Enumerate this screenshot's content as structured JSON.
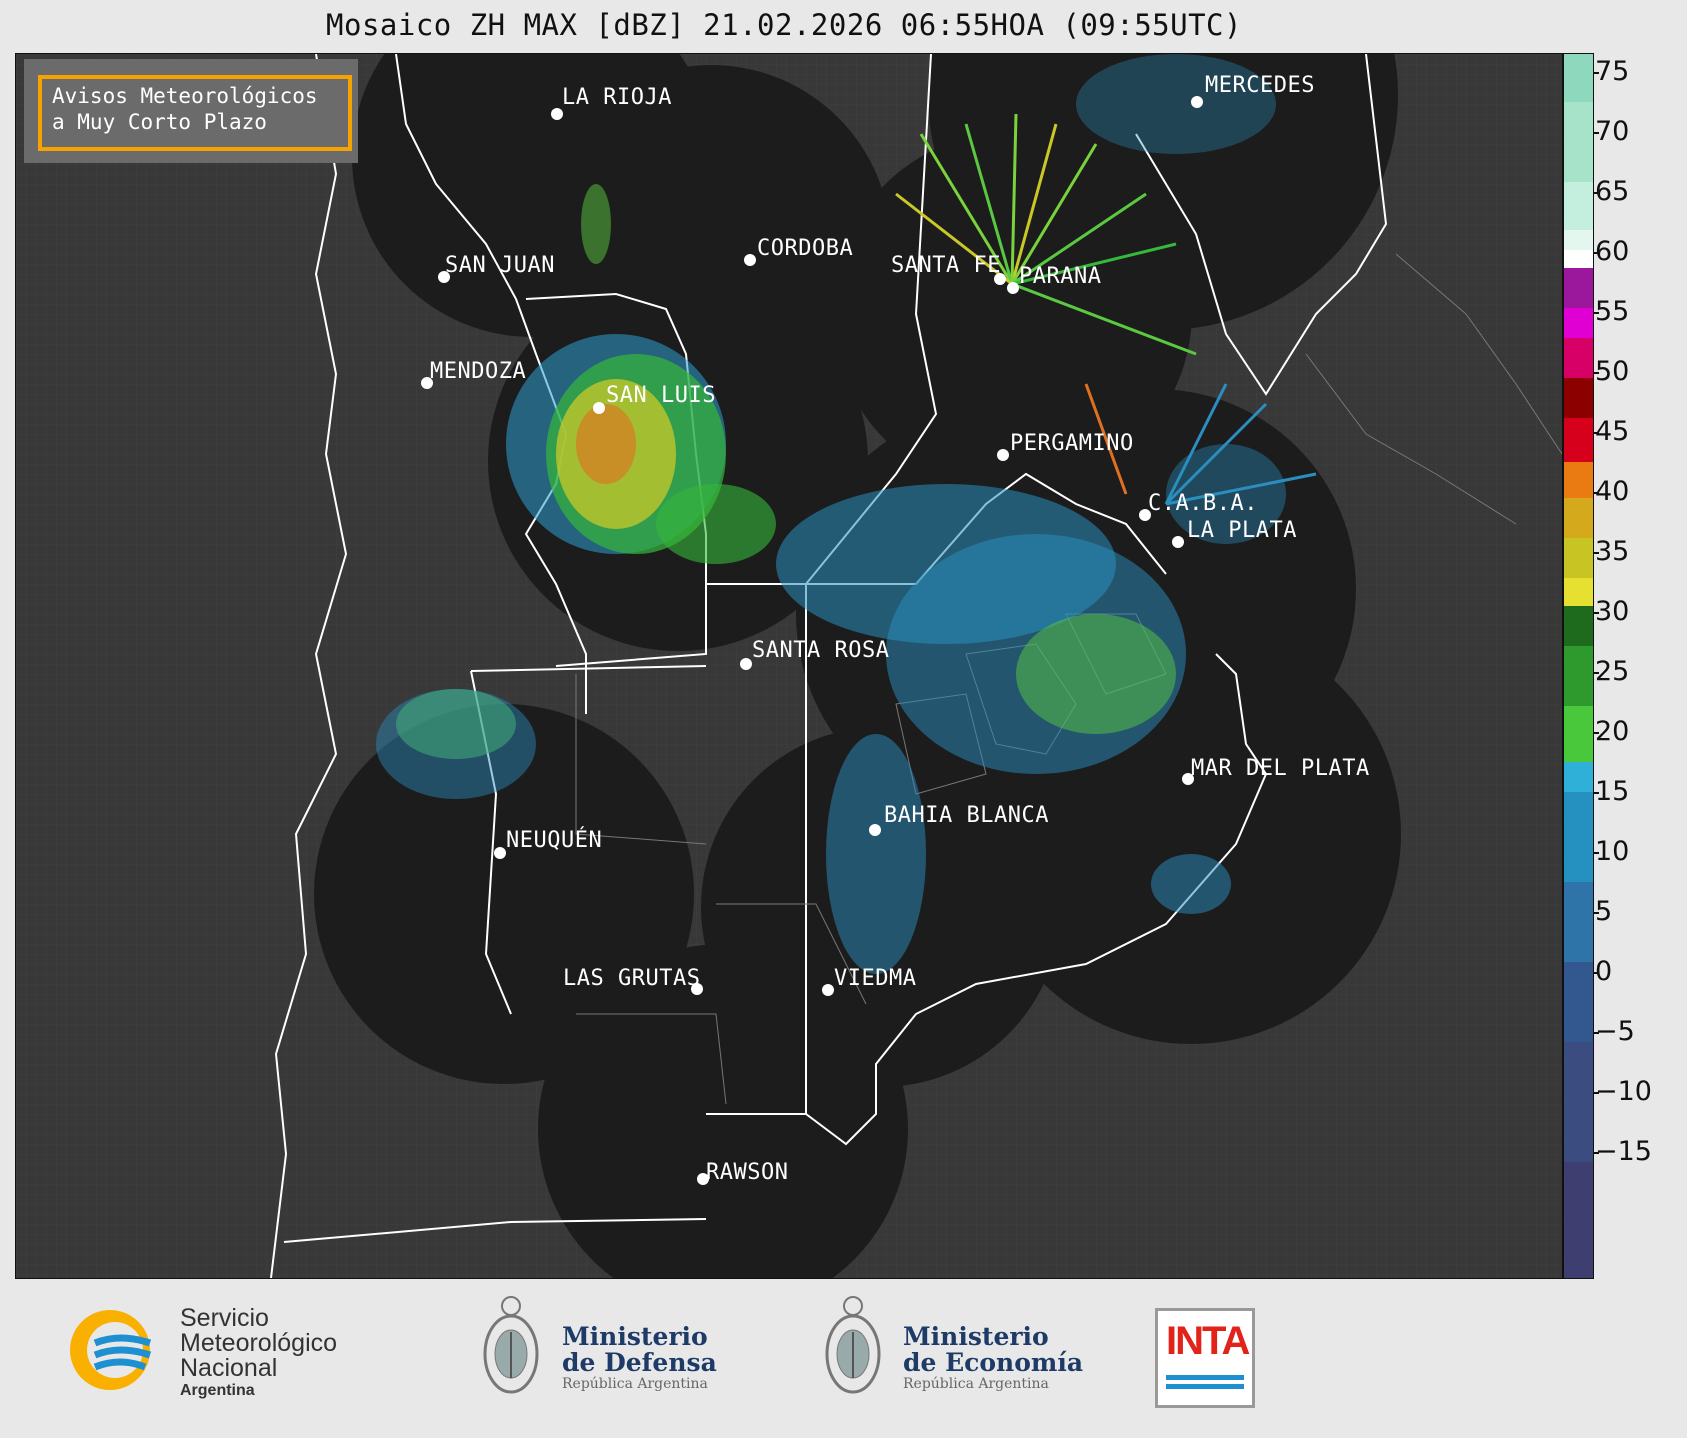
{
  "title": "Mosaico ZH MAX [dBZ] 21.02.2026 06:55HOA (09:55UTC)",
  "notice": {
    "line1": "Avisos Meteorológicos",
    "line2": "a Muy Corto Plazo"
  },
  "cities": [
    "LA RIOJA",
    "MERCEDES",
    "CORDOBA",
    "SAN JUAN",
    "SANTA FE",
    "PARANA",
    "MENDOZA",
    "SAN LUIS",
    "PERGAMINO",
    "C.A.B.A.",
    "LA PLATA",
    "SANTA ROSA",
    "MAR DEL PLATA",
    "BAHIA BLANCA",
    "NEUQUÉN",
    "LAS GRUTAS",
    "VIEDMA",
    "RAWSON"
  ],
  "colorbar": {
    "unit": "dBZ",
    "ticks": [
      "75",
      "70",
      "65",
      "60",
      "55",
      "50",
      "45",
      "40",
      "35",
      "30",
      "25",
      "20",
      "15",
      "10",
      "5",
      "0",
      "−5",
      "−10",
      "−15"
    ],
    "min": -19,
    "max": 77
  },
  "logos": {
    "smn": {
      "line1": "Servicio",
      "line2": "Meteorológico",
      "line3": "Nacional",
      "line4": "Argentina"
    },
    "defensa": {
      "line1": "Ministerio",
      "line2": "de Defensa",
      "line3": "República Argentina"
    },
    "economia": {
      "line1": "Ministerio",
      "line2": "de Economía",
      "line3": "República Argentina"
    },
    "inta": "INTA"
  },
  "colors": {
    "background": "#383838",
    "radar_coverage": "#1c1c1c",
    "notice_border": "#f4a300"
  }
}
